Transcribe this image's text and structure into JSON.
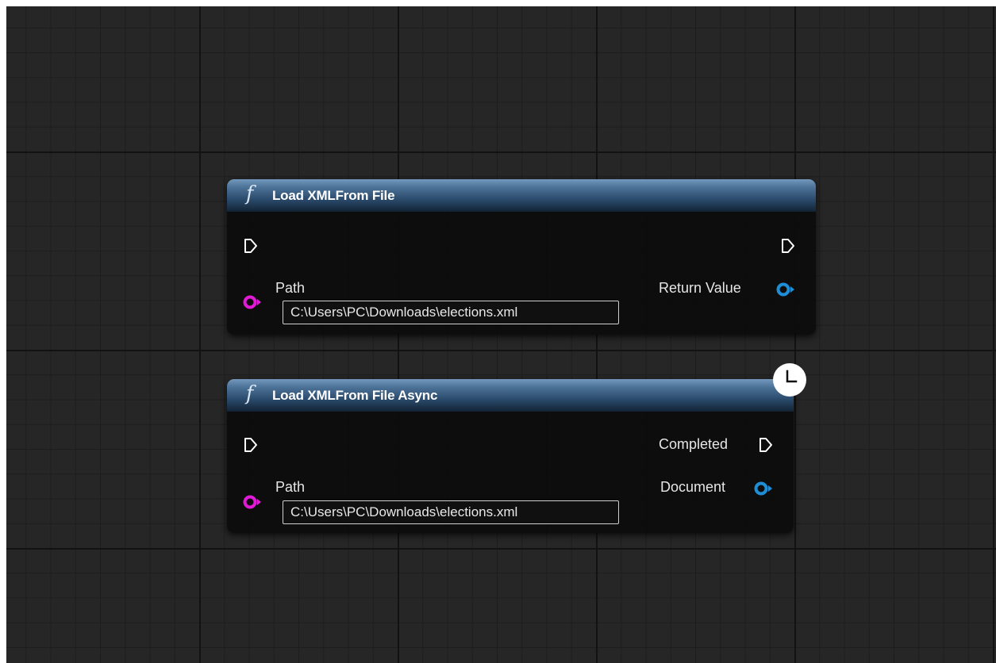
{
  "colors": {
    "graph_background": "#262626",
    "header_blue": "#3b6187",
    "string_pin": "#e01ad6",
    "object_pin": "#1e8fd6",
    "exec_pin": "#ffffff"
  },
  "nodes": [
    {
      "title": "Load XMLFrom File",
      "icon": "function-icon",
      "inputs": {
        "exec": "exec-in-pin",
        "path_label": "Path",
        "path_value": "C:\\Users\\PC\\Downloads\\elections.xml"
      },
      "outputs": {
        "exec": "exec-out-pin",
        "return_label": "Return Value"
      }
    },
    {
      "title": "Load XMLFrom File Async",
      "icon": "function-icon",
      "latent_icon": "clock-icon",
      "inputs": {
        "exec": "exec-in-pin",
        "path_label": "Path",
        "path_value": "C:\\Users\\PC\\Downloads\\elections.xml"
      },
      "outputs": {
        "completed_label": "Completed",
        "document_label": "Document"
      }
    }
  ]
}
